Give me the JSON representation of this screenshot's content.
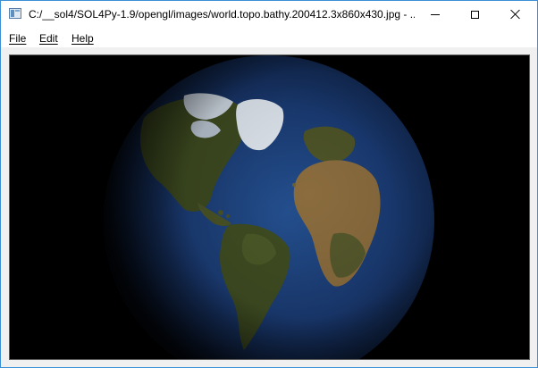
{
  "window": {
    "title": "C:/__sol4/SOL4Py-1.9/opengl/images/world.topo.bathy.200412.3x860x430.jpg - ..."
  },
  "menu": {
    "file": "File",
    "edit": "Edit",
    "help": "Help"
  },
  "icons": {
    "app": "app-window-icon",
    "minimize": "minimize-icon",
    "maximize": "maximize-icon",
    "close": "close-icon"
  },
  "colors": {
    "ocean": "#1d3f7a",
    "land": "#3d4a20",
    "desert": "#8a6c3e",
    "ice": "#dfe6ee",
    "background": "#000000"
  }
}
